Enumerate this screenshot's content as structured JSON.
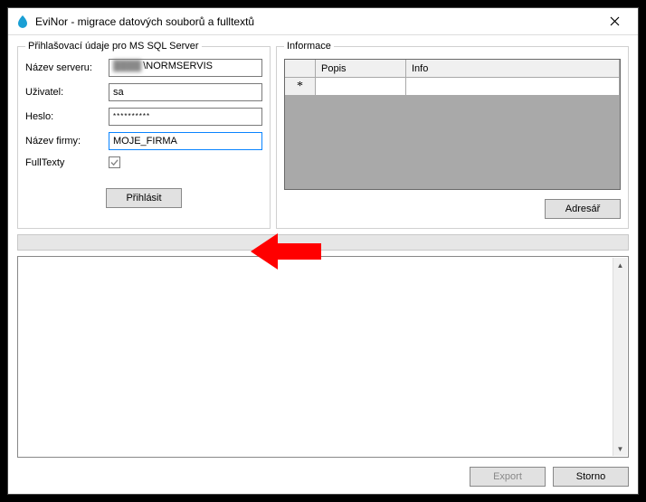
{
  "window": {
    "title": "EviNor - migrace datových souborů a fulltextů"
  },
  "login": {
    "legend": "Přihlašovací údaje pro MS SQL Server",
    "server_label": "Název serveru:",
    "server_value": "\\NORMSERVIS",
    "user_label": "Uživatel:",
    "user_value": "sa",
    "password_label": "Heslo:",
    "password_masked": "**********",
    "firm_label": "Název firmy:",
    "firm_value": "MOJE_FIRMA",
    "fulltext_label": "FullTexty",
    "fulltext_checked": true,
    "login_button": "Přihlásit"
  },
  "info": {
    "legend": "Informace",
    "columns": {
      "popis": "Popis",
      "info": "Info"
    },
    "row_marker": "*",
    "adresar_button": "Adresář"
  },
  "footer": {
    "export_button": "Export",
    "storno_button": "Storno"
  },
  "annotation": {
    "arrow_points_to": "login-button"
  }
}
